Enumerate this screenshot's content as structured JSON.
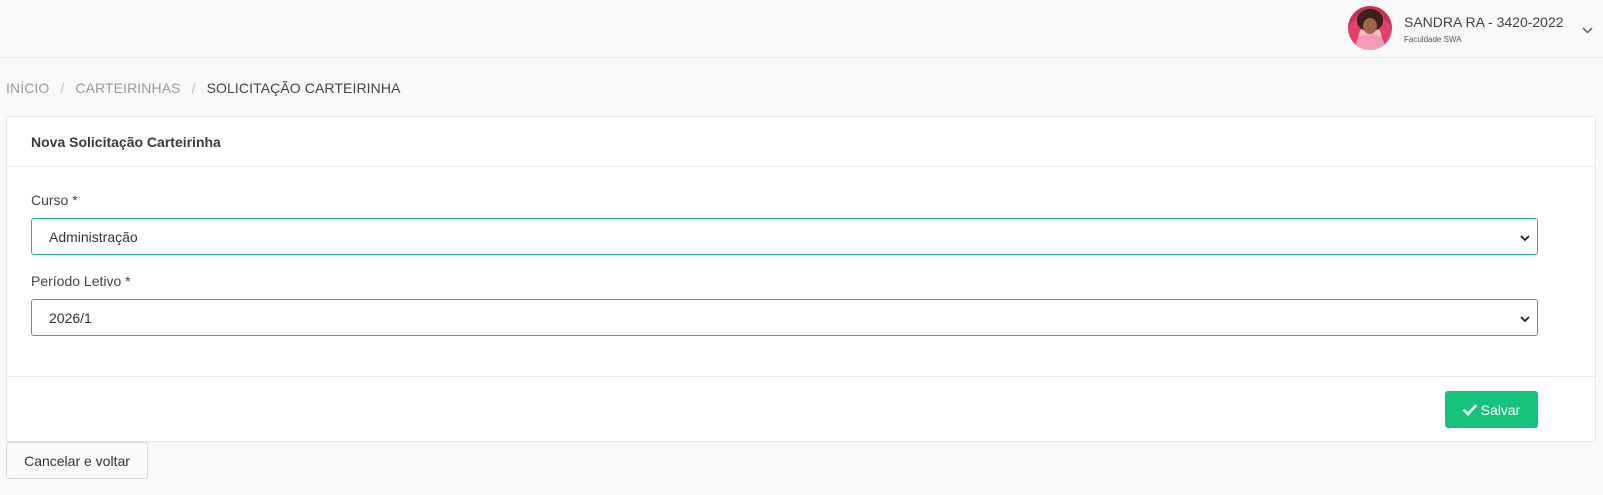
{
  "user": {
    "name": "SANDRA RA - 3420-2022",
    "institution": "Faculdade SWA"
  },
  "breadcrumb": {
    "items": [
      "INÍCIO",
      "CARTEIRINHAS"
    ],
    "separator": "/",
    "active": "SOLICITAÇÃO CARTEIRINHA"
  },
  "card": {
    "title": "Nova Solicitação Carteirinha",
    "fields": [
      {
        "label": "Curso *",
        "value": "Administração"
      },
      {
        "label": "Período Letivo *",
        "value": "2026/1"
      }
    ]
  },
  "actions": {
    "save_label": "Salvar",
    "cancel_label": "Cancelar e voltar"
  },
  "colors": {
    "accent": "#17c27a",
    "field_border": "#1abc7b"
  },
  "icons": {
    "user_menu": "chevron-down-icon",
    "select": "chevron-down-icon",
    "save": "check-icon"
  }
}
